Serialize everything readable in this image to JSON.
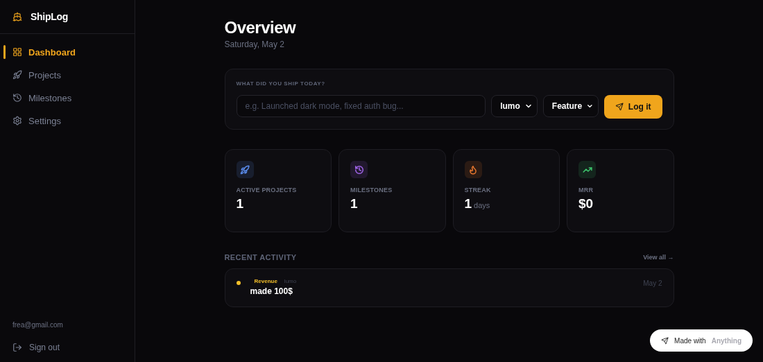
{
  "brand": {
    "name": "ShipLog"
  },
  "nav": [
    {
      "label": "Dashboard",
      "selected": true
    },
    {
      "label": "Projects",
      "selected": false
    },
    {
      "label": "Milestones",
      "selected": false
    },
    {
      "label": "Settings",
      "selected": false
    }
  ],
  "account": {
    "email": "frea@gmail.com",
    "sign_out": "Sign out"
  },
  "header": {
    "title": "Overview",
    "date": "Saturday, May 2"
  },
  "ship_form": {
    "label": "WHAT DID YOU SHIP TODAY?",
    "placeholder": "e.g. Launched dark mode, fixed auth bug...",
    "project": "lumo",
    "type": "Feature",
    "submit": "Log it"
  },
  "stats": [
    {
      "color": "#5b8def",
      "label": "ACTIVE PROJECTS",
      "value": "1"
    },
    {
      "color": "#a064e8",
      "label": "MILESTONES",
      "value": "1"
    },
    {
      "color": "#e8772e",
      "label": "STREAK",
      "value": "1",
      "unit": "days"
    },
    {
      "color": "#3ec46d",
      "label": "MRR",
      "value": "$0"
    }
  ],
  "recent_activity": {
    "title": "RECENT ACTIVITY",
    "view_all": "View all →",
    "items": [
      {
        "color": "#f5c02a",
        "type": "Revenue",
        "project": "lumo",
        "text": "made 100$",
        "date": "May 2"
      }
    ]
  },
  "badge": {
    "label": "Made with",
    "brand": "Anything"
  }
}
